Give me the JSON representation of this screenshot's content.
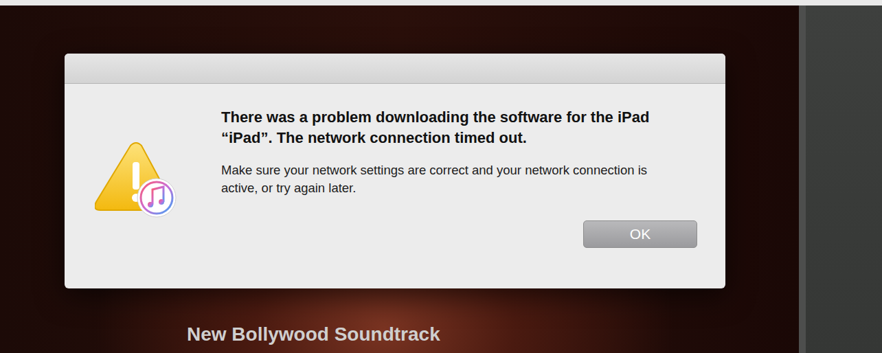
{
  "banner": {
    "caption": "New Bollywood Soundtrack"
  },
  "dialog": {
    "title": "There was a problem downloading the software for the iPad “iPad”. The network connection timed out.",
    "message": "Make sure your network settings are correct and your network connection is active, or try again later.",
    "buttons": [
      "OK"
    ]
  }
}
